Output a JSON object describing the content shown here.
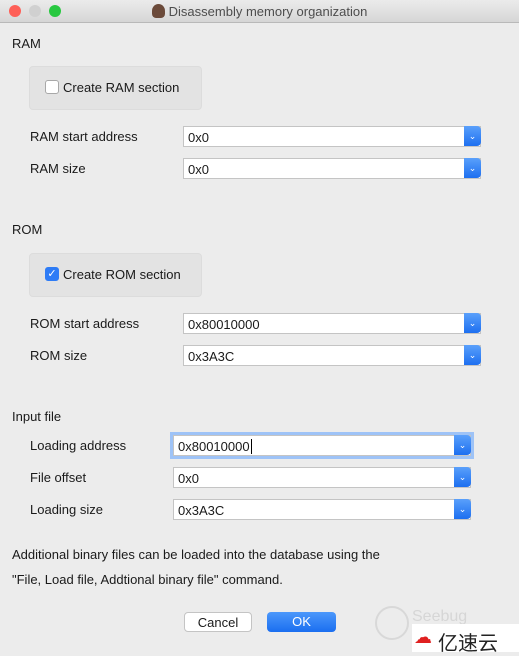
{
  "window": {
    "title": "Disassembly memory organization"
  },
  "ram": {
    "heading": "RAM",
    "create_label": "Create RAM section",
    "create_checked": false,
    "start_label": "RAM start address",
    "start_value": "0x0",
    "size_label": "RAM size",
    "size_value": "0x0"
  },
  "rom": {
    "heading": "ROM",
    "create_label": "Create ROM section",
    "create_checked": true,
    "start_label": "ROM start address",
    "start_value": "0x80010000",
    "size_label": "ROM size",
    "size_value": "0x3A3C"
  },
  "input": {
    "heading": "Input file",
    "loading_address_label": "Loading address",
    "loading_address_value": "0x80010000",
    "file_offset_label": "File offset",
    "file_offset_value": "0x0",
    "loading_size_label": "Loading size",
    "loading_size_value": "0x3A3C"
  },
  "info": {
    "line1": "Additional binary files can be loaded into the database using the",
    "line2": "\"File, Load file, Addtional binary file\" command."
  },
  "buttons": {
    "cancel": "Cancel",
    "ok": "OK"
  },
  "watermark": {
    "seebug": "Seebug",
    "yisu": "亿速云"
  },
  "colors": {
    "accent": "#2e7cf6"
  }
}
